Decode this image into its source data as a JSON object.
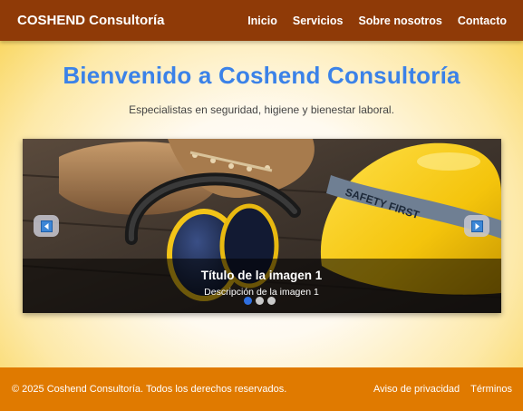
{
  "header": {
    "brand": "COSHEND Consultoría",
    "nav": [
      "Inicio",
      "Servicios",
      "Sobre nosotros",
      "Contacto"
    ]
  },
  "hero": {
    "title": "Bienvenido a Coshend Consultoría",
    "subtitle": "Especialistas en seguridad, higiene y bienestar laboral."
  },
  "carousel": {
    "caption_title": "Título de la imagen 1",
    "caption_description": "Descripción de la imagen 1",
    "helmet_text": "SAFETY FIRST",
    "prev_icon": "chevron-left-icon",
    "next_icon": "chevron-right-icon",
    "slides_count": 3,
    "active_slide": 1
  },
  "footer": {
    "copyright": "© 2025 Coshend Consultoría. Todos los derechos reservados.",
    "links": [
      "Aviso de privacidad",
      "Términos"
    ]
  },
  "colors": {
    "navbar": "#8f3a07",
    "footer": "#e07a00",
    "hero_title": "#3b82e8",
    "active_dot": "#2f6fe0"
  }
}
